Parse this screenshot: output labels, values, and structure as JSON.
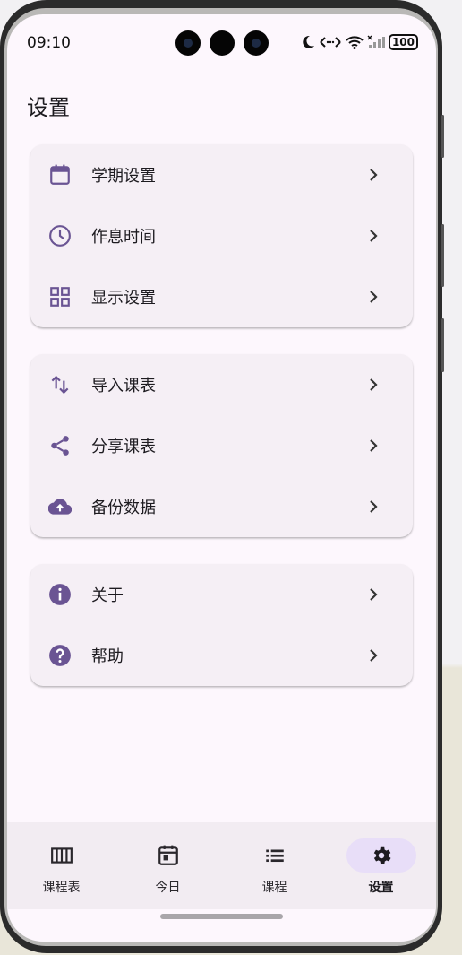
{
  "status_bar": {
    "time": "09:10",
    "battery": "100"
  },
  "page": {
    "title": "设置"
  },
  "groups": [
    {
      "items": [
        {
          "label": "学期设置",
          "icon": "calendar-icon"
        },
        {
          "label": "作息时间",
          "icon": "clock-icon"
        },
        {
          "label": "显示设置",
          "icon": "grid-icon"
        }
      ]
    },
    {
      "items": [
        {
          "label": "导入课表",
          "icon": "import-arrows-icon"
        },
        {
          "label": "分享课表",
          "icon": "share-icon"
        },
        {
          "label": "备份数据",
          "icon": "cloud-upload-icon"
        }
      ]
    },
    {
      "items": [
        {
          "label": "关于",
          "icon": "info-icon"
        },
        {
          "label": "帮助",
          "icon": "help-icon"
        }
      ]
    }
  ],
  "bottom_nav": {
    "items": [
      {
        "label": "课程表",
        "icon": "timetable-icon",
        "active": false
      },
      {
        "label": "今日",
        "icon": "today-calendar-icon",
        "active": false
      },
      {
        "label": "课程",
        "icon": "list-icon",
        "active": false
      },
      {
        "label": "设置",
        "icon": "gear-icon",
        "active": true
      }
    ]
  },
  "colors": {
    "accent": "#6a5493",
    "surface": "#fdf7fd",
    "card": "#f5eff5",
    "nav_active_pill": "#e8def8"
  }
}
